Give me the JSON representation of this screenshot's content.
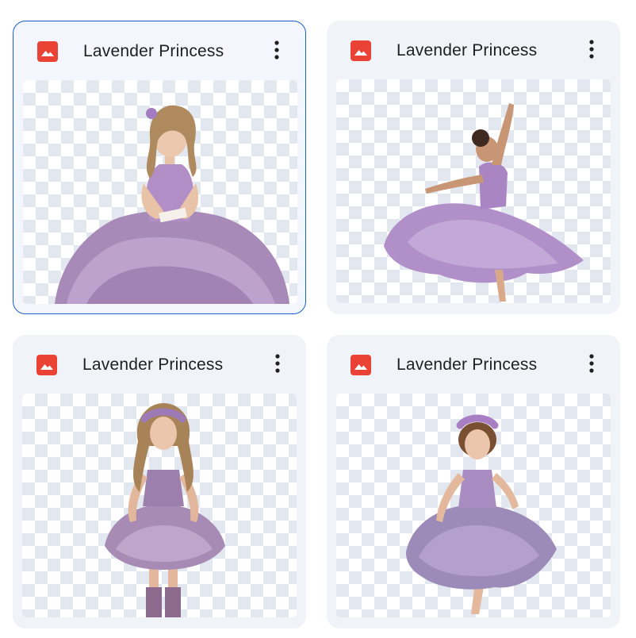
{
  "files": [
    {
      "name": "Lavender Princess",
      "icon": "image-file-icon",
      "icon_color": "#ea4335",
      "menu_icon": "more-vert-icon",
      "selected": true,
      "thumbnail": "girl-reading-book-in-lavender-gown"
    },
    {
      "name": "Lavender Princess",
      "icon": "image-file-icon",
      "icon_color": "#ea4335",
      "menu_icon": "more-vert-icon",
      "selected": false,
      "thumbnail": "girl-dancing-in-lavender-dress"
    },
    {
      "name": "Lavender Princess",
      "icon": "image-file-icon",
      "icon_color": "#ea4335",
      "menu_icon": "more-vert-icon",
      "selected": false,
      "thumbnail": "girl-with-flower-crown-in-tutu-dress"
    },
    {
      "name": "Lavender Princess",
      "icon": "image-file-icon",
      "icon_color": "#ea4335",
      "menu_icon": "more-vert-icon",
      "selected": false,
      "thumbnail": "girl-twirling-in-floral-lavender-dress"
    }
  ],
  "colors": {
    "card_background": "#f0f4f9",
    "selected_border": "#1a5fc9",
    "dress_lavender": "#b79bc7",
    "hair_brown": "#8a5a3a"
  }
}
